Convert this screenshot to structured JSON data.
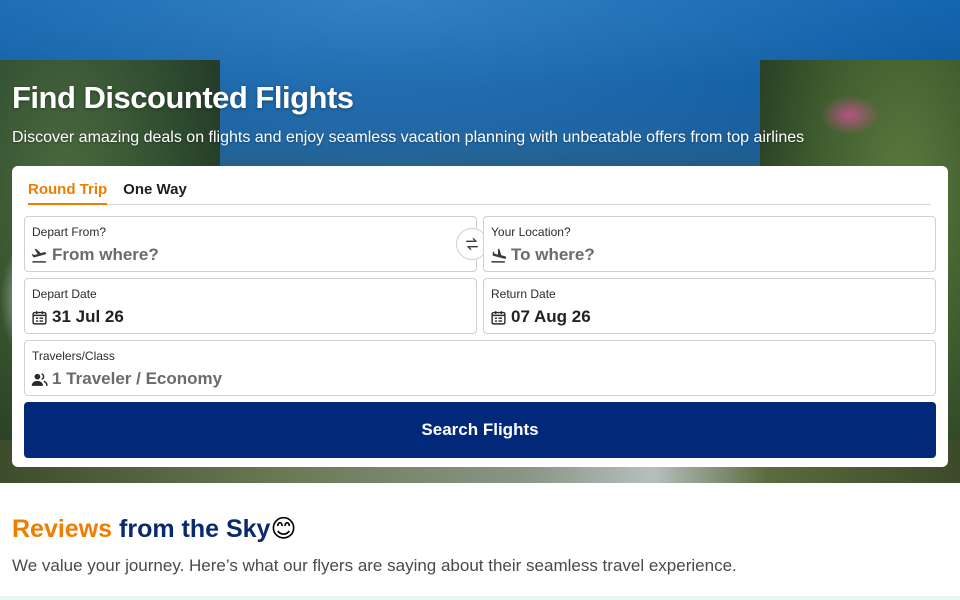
{
  "hero": {
    "title": "Find Discounted Flights",
    "subtitle": "Discover amazing deals on flights and enjoy seamless vacation planning with unbeatable offers from top airlines"
  },
  "search": {
    "tabs": [
      {
        "label": "Round Trip",
        "active": true
      },
      {
        "label": "One Way",
        "active": false
      }
    ],
    "from": {
      "label": "Depart From?",
      "placeholder": "From where?",
      "icon": "plane-takeoff-icon"
    },
    "to": {
      "label": "Your Location?",
      "placeholder": "To where?",
      "icon": "plane-landing-icon"
    },
    "depart_date": {
      "label": "Depart Date",
      "value": "31 Jul 26",
      "icon": "calendar-icon"
    },
    "return_date": {
      "label": "Return Date",
      "value": "07 Aug 26",
      "icon": "calendar-icon"
    },
    "travelers": {
      "label": "Travelers/Class",
      "value": "1 Traveler / Economy",
      "icon": "users-icon"
    },
    "swap_icon": "swap-arrows-icon",
    "button_label": "Search Flights"
  },
  "reviews": {
    "title_part1": "Reviews",
    "title_part2": "from the Sky",
    "title_emoji": "😊",
    "subtitle": "We value your journey. Here’s what our flyers are saying about their seamless travel experience."
  },
  "colors": {
    "accent_orange": "#f07c00",
    "brand_navy": "#02287a",
    "heading_navy": "#0b2a6b"
  }
}
